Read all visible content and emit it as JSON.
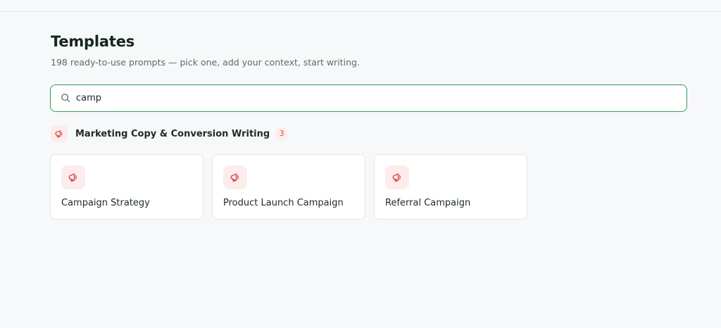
{
  "header": {
    "title": "Templates",
    "subtitle": "198 ready-to-use prompts — pick one, add your context, start writing."
  },
  "search": {
    "value": "camp",
    "icon": "search-icon"
  },
  "category": {
    "label": "Marketing Copy & Conversion Writing",
    "count": "3",
    "icon": "megaphone-icon",
    "accent": "#d94848"
  },
  "cards": [
    {
      "title": "Campaign Strategy",
      "icon": "megaphone-icon"
    },
    {
      "title": "Product Launch Campaign",
      "icon": "megaphone-icon"
    },
    {
      "title": "Referral Campaign",
      "icon": "megaphone-icon"
    }
  ],
  "colors": {
    "focus_border": "#2f9e57",
    "icon_bg": "#fdecec",
    "icon_fg": "#d94848"
  }
}
